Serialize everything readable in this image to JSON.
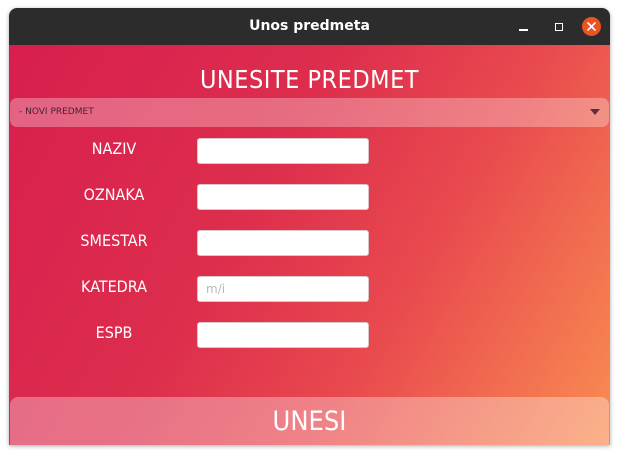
{
  "window": {
    "title": "Unos predmeta",
    "controls": {
      "minimize_icon": "minimize-icon",
      "maximize_icon": "maximize-icon",
      "close_icon": "close-icon"
    },
    "close_color": "#e95420",
    "titlebar_color": "#2c2c2c"
  },
  "form": {
    "heading": "UNESITE PREDMET",
    "subject_select": {
      "value": "- NOVI PREDMET"
    },
    "fields": [
      {
        "label": "NAZIV",
        "value": "",
        "placeholder": ""
      },
      {
        "label": "OZNAKA",
        "value": "",
        "placeholder": ""
      },
      {
        "label": "SMESTAR",
        "value": "",
        "placeholder": ""
      },
      {
        "label": "KATEDRA",
        "value": "",
        "placeholder": "m/i"
      },
      {
        "label": "ESPB",
        "value": "",
        "placeholder": ""
      }
    ],
    "submit_label": "UNESI",
    "gradient": {
      "start": "#d81e4e",
      "end": "#fa8d52"
    }
  }
}
